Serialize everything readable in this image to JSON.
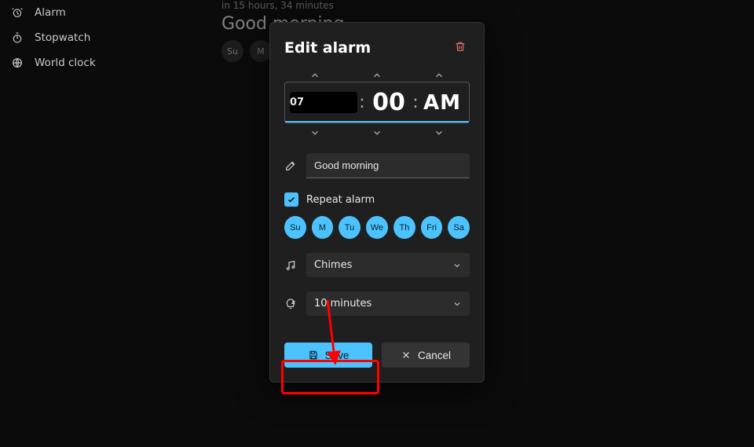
{
  "sidebar": {
    "items": [
      {
        "label": "Alarm"
      },
      {
        "label": "Stopwatch"
      },
      {
        "label": "World clock"
      }
    ]
  },
  "bg": {
    "subtitle": "in 15 hours, 34 minutes",
    "title": "Good morning",
    "days": [
      "Su",
      "M"
    ]
  },
  "dialog": {
    "title": "Edit alarm",
    "hour": "07",
    "minute": "00",
    "ampm": "AM",
    "colon": ":",
    "name": "Good morning",
    "repeat_label": "Repeat alarm",
    "days": [
      "Su",
      "M",
      "Tu",
      "We",
      "Th",
      "Fri",
      "Sa"
    ],
    "sound": "Chimes",
    "snooze": "10 minutes",
    "save_label": "Save",
    "cancel_label": "Cancel"
  }
}
